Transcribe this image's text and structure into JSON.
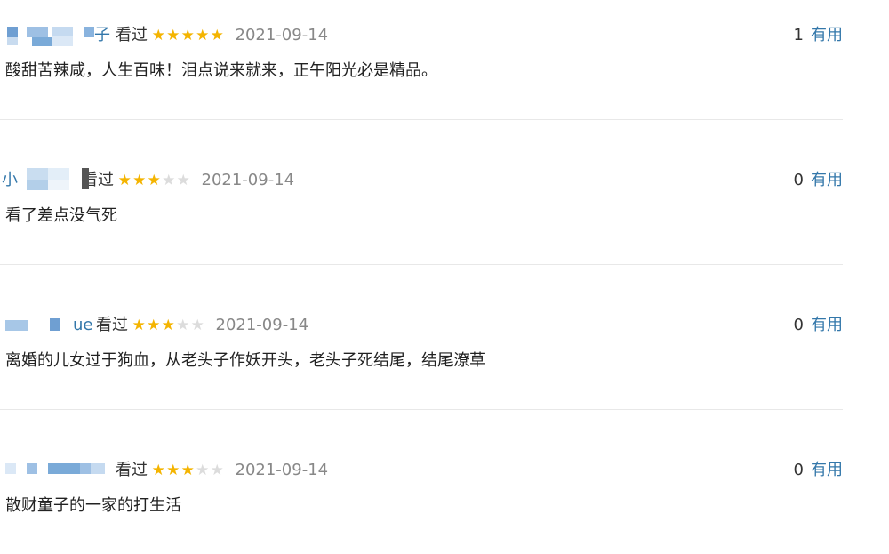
{
  "comments": [
    {
      "username_visible": "子",
      "status": "看过",
      "rating": 5,
      "date": "2021-09-14",
      "votes": "1",
      "useful_label": "有用",
      "text": "酸甜苦辣咸，人生百味！泪点说来就来，正午阳光必是精品。"
    },
    {
      "username_visible": "小",
      "status": "看过",
      "rating": 3,
      "date": "2021-09-14",
      "votes": "0",
      "useful_label": "有用",
      "text": "看了差点没气死"
    },
    {
      "username_visible": "ue",
      "status": "看过",
      "rating": 3,
      "date": "2021-09-14",
      "votes": "0",
      "useful_label": "有用",
      "text": "离婚的儿女过于狗血，从老头子作妖开头，老头子死结尾，结尾潦草"
    },
    {
      "username_visible": "",
      "status": "看过",
      "rating": 3,
      "date": "2021-09-14",
      "votes": "0",
      "useful_label": "有用",
      "text": "散财童子的一家的打生活"
    }
  ],
  "icons": {
    "star_full": "star-filled-icon",
    "star_empty": "star-empty-icon"
  },
  "colors": {
    "link": "#3377aa",
    "star": "#f4b400",
    "star_empty": "#dcdcdc",
    "date": "#888888",
    "divider": "#e8e8e8",
    "mosaic_dark": "#7aaad8",
    "mosaic_light": "#c9ddf0"
  }
}
